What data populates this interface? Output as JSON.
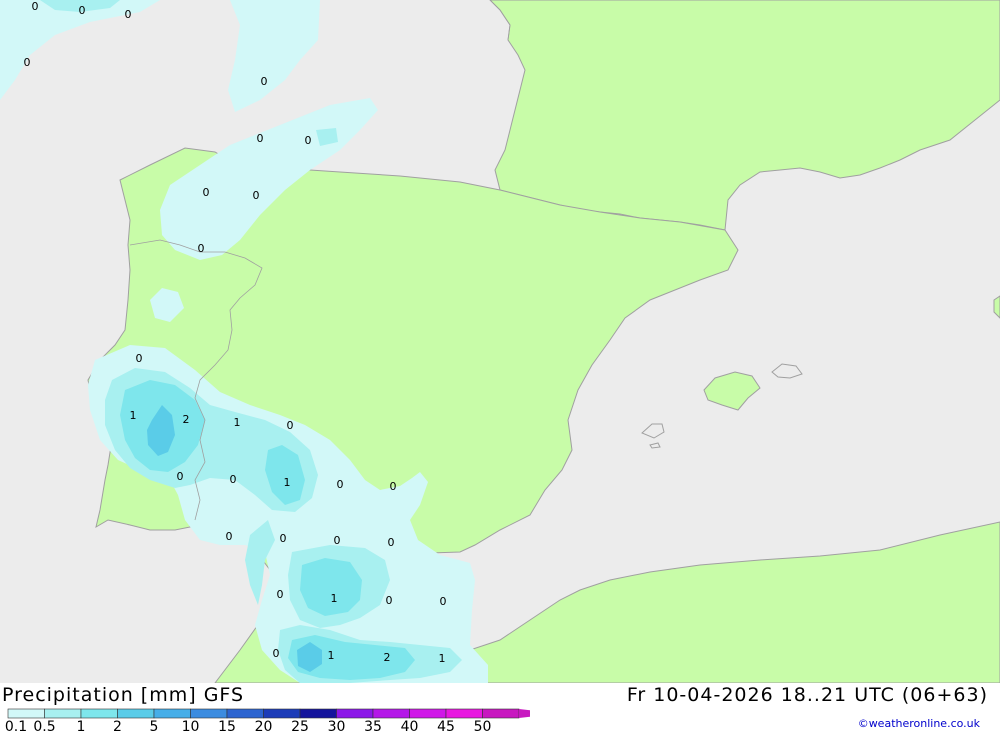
{
  "header": {
    "product_label": "Precipitation [mm]",
    "model_label": "GFS",
    "valid_time": "Fr 10-04-2026 18..21 UTC (06+63)"
  },
  "footer": {
    "credit": "©weatheronline.co.uk"
  },
  "colors": {
    "sea": "#ececec",
    "land": "#c8fca8",
    "coast": "#a0a0a0",
    "precip_0_1": "#d2f8f8",
    "precip_0_5": "#a8f0f0",
    "precip_1": "#7ee6ec",
    "precip_2": "#5acce8"
  },
  "legend": {
    "ticks": [
      "0.1",
      "0.5",
      "1",
      "2",
      "5",
      "10",
      "15",
      "20",
      "25",
      "30",
      "35",
      "40",
      "45",
      "50"
    ],
    "colors": [
      "#d2f8f8",
      "#a8f0f0",
      "#7ee6ec",
      "#5acce8",
      "#46aee8",
      "#3c8ce0",
      "#2c64d0",
      "#1c3cb8",
      "#14149c",
      "#8c18e8",
      "#b418e8",
      "#d018e8",
      "#e818e0",
      "#c818c0"
    ]
  },
  "map_labels": [
    {
      "text": "0"
    },
    {
      "text": "0"
    },
    {
      "text": "0"
    },
    {
      "text": "0"
    },
    {
      "text": "0"
    },
    {
      "text": "0"
    },
    {
      "text": "0"
    },
    {
      "text": "0"
    },
    {
      "text": "0"
    },
    {
      "text": "0"
    },
    {
      "text": "0"
    },
    {
      "text": "1"
    },
    {
      "text": "2"
    },
    {
      "text": "1"
    },
    {
      "text": "0"
    },
    {
      "text": "0"
    },
    {
      "text": "0"
    },
    {
      "text": "1"
    },
    {
      "text": "0"
    },
    {
      "text": "0"
    },
    {
      "text": "0"
    },
    {
      "text": "0"
    },
    {
      "text": "0"
    },
    {
      "text": "0"
    },
    {
      "text": "0"
    },
    {
      "text": "1"
    },
    {
      "text": "0"
    },
    {
      "text": "0"
    },
    {
      "text": "0"
    },
    {
      "text": "1"
    },
    {
      "text": "2"
    },
    {
      "text": "1"
    }
  ]
}
